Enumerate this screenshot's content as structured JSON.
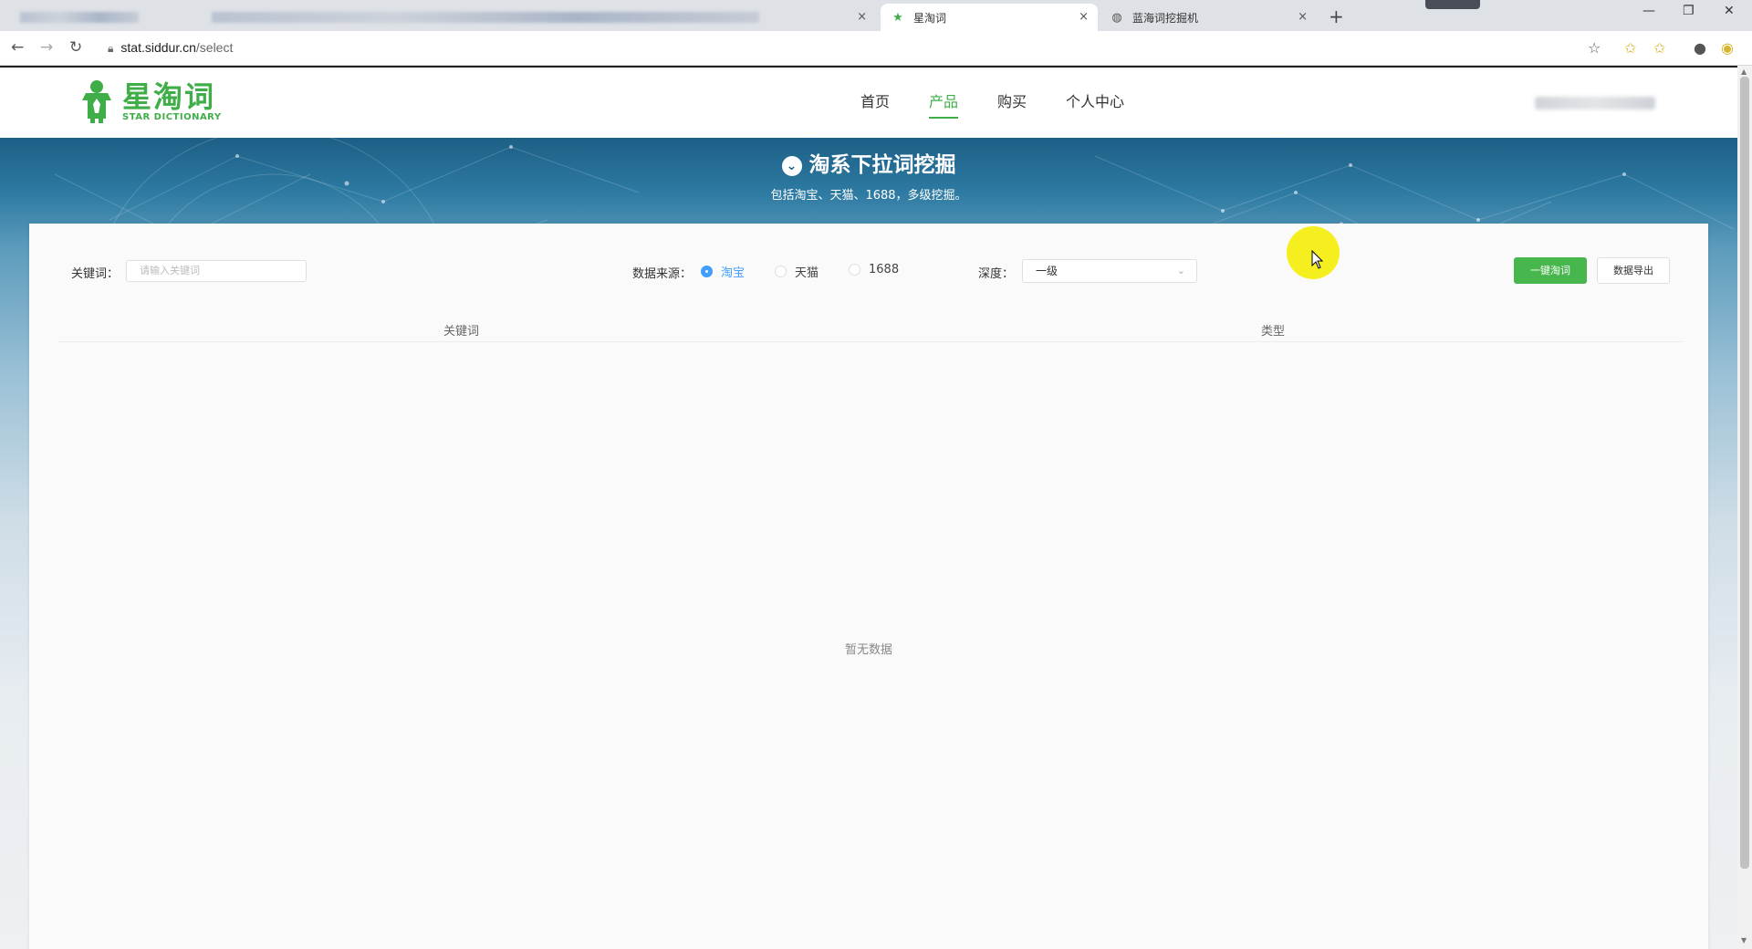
{
  "browser": {
    "tabs": [
      {
        "title": "",
        "state": "blurred"
      },
      {
        "title": "",
        "state": "blurred"
      },
      {
        "title": "星淘词",
        "state": "active"
      },
      {
        "title": "蓝海词挖掘机",
        "state": "inactive"
      }
    ],
    "new_tab_label": "+",
    "close_label": "×",
    "url_host": "stat.siddur.cn",
    "url_path": "/select"
  },
  "site": {
    "logo_cn": "星淘词",
    "logo_en": "STAR DICTIONARY",
    "brand_color": "#3fae49",
    "nav": [
      {
        "label": "首页"
      },
      {
        "label": "产品",
        "active": true
      },
      {
        "label": "购买"
      },
      {
        "label": "个人中心"
      }
    ]
  },
  "banner": {
    "title": "淘系下拉词挖掘",
    "subtitle": "包括淘宝、天猫、1688，多级挖掘。"
  },
  "filters": {
    "keyword_label": "关键词：",
    "keyword_placeholder": "请输入关键词",
    "source_label": "数据来源：",
    "sources": [
      {
        "label": "淘宝",
        "checked": true
      },
      {
        "label": "天猫",
        "checked": false
      },
      {
        "label": "1688",
        "checked": false
      }
    ],
    "depth_label": "深度：",
    "depth_value": "一级",
    "primary_button": "一键淘词",
    "export_button": "数据导出"
  },
  "table": {
    "columns": [
      "关键词",
      "类型"
    ],
    "empty_text": "暂无数据"
  }
}
